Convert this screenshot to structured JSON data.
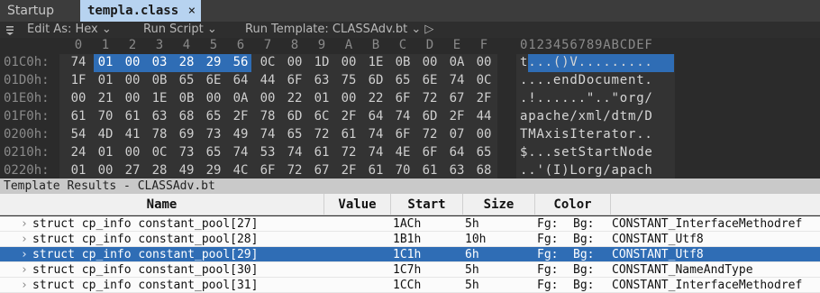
{
  "tabs": [
    {
      "label": "Startup",
      "active": false
    },
    {
      "label": "templa.class",
      "active": true,
      "close": "×"
    }
  ],
  "toolbar": {
    "menu_icon": "hamburger-icon",
    "edit_as": "Edit As: Hex ⌄",
    "run_script": "Run Script ⌄",
    "run_template": "Run Template: CLASSAdv.bt ⌄ ▷"
  },
  "hex": {
    "columns": [
      "0",
      "1",
      "2",
      "3",
      "4",
      "5",
      "6",
      "7",
      "8",
      "9",
      "A",
      "B",
      "C",
      "D",
      "E",
      "F"
    ],
    "ascii_header": "0123456789ABCDEF",
    "rows": [
      {
        "addr": "01C0h:",
        "bytes": [
          "74",
          "01",
          "00",
          "03",
          "28",
          "29",
          "56",
          "0C",
          "00",
          "1D",
          "00",
          "1E",
          "0B",
          "00",
          "0A",
          "00"
        ],
        "ascii": "t...()V........."
      },
      {
        "addr": "01D0h:",
        "bytes": [
          "1F",
          "01",
          "00",
          "0B",
          "65",
          "6E",
          "64",
          "44",
          "6F",
          "63",
          "75",
          "6D",
          "65",
          "6E",
          "74",
          "0C"
        ],
        "ascii": "....endDocument."
      },
      {
        "addr": "01E0h:",
        "bytes": [
          "00",
          "21",
          "00",
          "1E",
          "0B",
          "00",
          "0A",
          "00",
          "22",
          "01",
          "00",
          "22",
          "6F",
          "72",
          "67",
          "2F"
        ],
        "ascii": ".!......\"..\"org/"
      },
      {
        "addr": "01F0h:",
        "bytes": [
          "61",
          "70",
          "61",
          "63",
          "68",
          "65",
          "2F",
          "78",
          "6D",
          "6C",
          "2F",
          "64",
          "74",
          "6D",
          "2F",
          "44"
        ],
        "ascii": "apache/xml/dtm/D"
      },
      {
        "addr": "0200h:",
        "bytes": [
          "54",
          "4D",
          "41",
          "78",
          "69",
          "73",
          "49",
          "74",
          "65",
          "72",
          "61",
          "74",
          "6F",
          "72",
          "07",
          "00"
        ],
        "ascii": "TMAxisIterator.."
      },
      {
        "addr": "0210h:",
        "bytes": [
          "24",
          "01",
          "00",
          "0C",
          "73",
          "65",
          "74",
          "53",
          "74",
          "61",
          "72",
          "74",
          "4E",
          "6F",
          "64",
          "65"
        ],
        "ascii": "$...setStartNode"
      },
      {
        "addr": "0220h:",
        "bytes": [
          "01",
          "00",
          "27",
          "28",
          "49",
          "29",
          "4C",
          "6F",
          "72",
          "67",
          "2F",
          "61",
          "70",
          "61",
          "63",
          "68"
        ],
        "ascii": "..'(I)Lorg/apach"
      }
    ]
  },
  "template": {
    "title": "Template Results - CLASSAdv.bt",
    "columns": {
      "name": "Name",
      "value": "Value",
      "start": "Start",
      "size": "Size",
      "color": "Color"
    },
    "rows": [
      {
        "name": "struct cp_info constant_pool[27]",
        "value": "",
        "start": "1ACh",
        "size": "5h",
        "fg": "Fg:",
        "bg": "Bg:",
        "type": "CONSTANT_InterfaceMethodref",
        "selected": false
      },
      {
        "name": "struct cp_info constant_pool[28]",
        "value": "",
        "start": "1B1h",
        "size": "10h",
        "fg": "Fg:",
        "bg": "Bg:",
        "type": "CONSTANT_Utf8",
        "selected": false
      },
      {
        "name": "struct cp_info constant_pool[29]",
        "value": "",
        "start": "1C1h",
        "size": "6h",
        "fg": "Fg:",
        "bg": "Bg:",
        "type": "CONSTANT_Utf8",
        "selected": true
      },
      {
        "name": "struct cp_info constant_pool[30]",
        "value": "",
        "start": "1C7h",
        "size": "5h",
        "fg": "Fg:",
        "bg": "Bg:",
        "type": "CONSTANT_NameAndType",
        "selected": false
      },
      {
        "name": "struct cp_info constant_pool[31]",
        "value": "",
        "start": "1CCh",
        "size": "5h",
        "fg": "Fg:",
        "bg": "Bg:",
        "type": "CONSTANT_InterfaceMethodref",
        "selected": false
      }
    ]
  },
  "colors": {
    "selection": "#2f6db5",
    "active_tab": "#b7d3f0",
    "background": "#2b2b2b"
  }
}
